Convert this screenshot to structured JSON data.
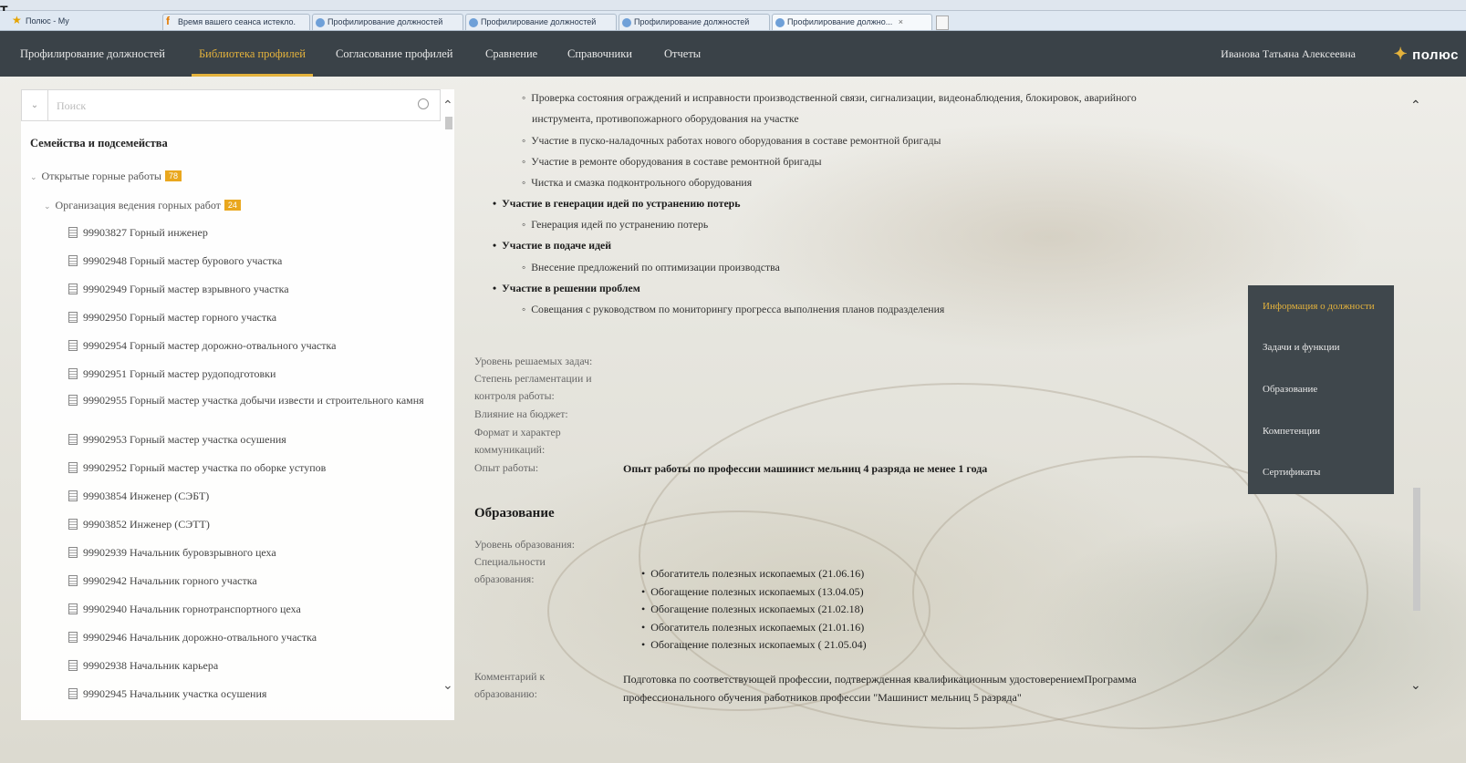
{
  "browser": {
    "corner_mark": "T",
    "tabs": [
      {
        "label": "Полюс - My"
      },
      {
        "label": "Время вашего сеанса истекло."
      },
      {
        "label": "Профилирование должностей"
      },
      {
        "label": "Профилирование должностей"
      },
      {
        "label": "Профилирование должностей"
      },
      {
        "label": "Профилирование должно..."
      }
    ],
    "tab_close": "×"
  },
  "nav": {
    "items": [
      {
        "label": "Профилирование должностей"
      },
      {
        "label": "Библиотека профилей"
      },
      {
        "label": "Согласование профилей"
      },
      {
        "label": "Сравнение"
      },
      {
        "label": "Справочники"
      },
      {
        "label": "Отчеты"
      }
    ],
    "user": "Иванова Татьяна Алексеевна",
    "logo": "полюс",
    "accent_color": "#e4b23c"
  },
  "sidebar": {
    "search_placeholder": "Поиск",
    "families_title": "Семейства и подсемейства",
    "level1": {
      "label": "Открытые горные работы",
      "count": "78"
    },
    "level2": {
      "label": "Организация ведения горных работ",
      "count": "24"
    },
    "items": [
      {
        "label": "99903827 Горный инженер"
      },
      {
        "label": "99902948 Горный мастер бурового участка"
      },
      {
        "label": "99902949 Горный мастер взрывного участка"
      },
      {
        "label": "99902950 Горный мастер горного участка"
      },
      {
        "label": "99902954 Горный мастер дорожно-отвального участка"
      },
      {
        "label": "99902951 Горный мастер рудоподготовки"
      },
      {
        "label": "99902955 Горный мастер участка добычи извести и строительного камня"
      },
      {
        "label": "99902953 Горный мастер участка осушения"
      },
      {
        "label": "99902952 Горный мастер участка по оборке уступов"
      },
      {
        "label": "99903854 Инженер (СЭБТ)"
      },
      {
        "label": "99903852 Инженер (СЭТТ)"
      },
      {
        "label": "99902939 Начальник буровзрывного цеха"
      },
      {
        "label": "99902942 Начальник горного участка"
      },
      {
        "label": "99902940 Начальник горнотранспортного цеха"
      },
      {
        "label": "99902946 Начальник дорожно-отвального участка"
      },
      {
        "label": "99902938 Начальник карьера"
      },
      {
        "label": "99902945 Начальник участка осушения"
      }
    ]
  },
  "content": {
    "tasks": [
      {
        "text": "Проверка состояния ограждений и исправности производственной связи, сигнализации, видеонаблюдения, блокировок, аварийного",
        "level": "sub"
      },
      {
        "text": "инструмента, противопожарного оборудования на участке",
        "level": "cont"
      },
      {
        "text": "Участие в пуско-наладочных работах нового оборудования в составе ремонтной бригады",
        "level": "sub"
      },
      {
        "text": "Участие в ремонте оборудования в составе ремонтной бригады",
        "level": "sub"
      },
      {
        "text": "Чистка и смазка подконтрольного оборудования",
        "level": "sub"
      },
      {
        "text": "Участие в генерации идей по устранению потерь",
        "level": "bold"
      },
      {
        "text": "Генерация идей по устранению потерь",
        "level": "sub"
      },
      {
        "text": "Участие в подаче идей",
        "level": "bold"
      },
      {
        "text": "Внесение предложений по оптимизации производства",
        "level": "sub"
      },
      {
        "text": "Участие в решении проблем",
        "level": "bold"
      },
      {
        "text": "Совещания с руководством по мониторингу прогресса выполнения планов подразделения",
        "level": "sub"
      }
    ],
    "attributes": {
      "level_label": "Уровень решаемых задач:",
      "regulation_label_1": "Степень регламентации и",
      "regulation_label_2": "контроля работы:",
      "budget_label": "Влияние на бюджет:",
      "communication_label_1": "Формат и характер",
      "communication_label_2": "коммуникаций:",
      "experience_label": "Опыт работы:",
      "experience_value": "Опыт работы по профессии машинист мельниц 4 разряда не менее 1 года"
    },
    "education": {
      "title": "Образование",
      "level_label": "Уровень образования:",
      "spec_label_1": "Специальности",
      "spec_label_2": "образования:",
      "specialties": [
        "Обогатитель полезных ископаемых (21.06.16)",
        "Обогащение полезных ископаемых (13.04.05)",
        "Обогащение полезных ископаемых (21.02.18)",
        "Обогатитель полезных ископаемых (21.01.16)",
        "Обогащение полезных ископаемых ( 21.05.04)"
      ],
      "comment_label_1": "Комментарий к",
      "comment_label_2": "образованию:",
      "comment_value_1": "Подготовка по соответствующей профессии, подтвержденная квалификационным удостоверениемПрограмма",
      "comment_value_2": "профессионального обучения работников профессии \"Машинист мельниц 5 разряда\""
    }
  },
  "right_nav": {
    "items": [
      {
        "label": "Информация о должности"
      },
      {
        "label": "Задачи и функции"
      },
      {
        "label": "Образование"
      },
      {
        "label": "Компетенции"
      },
      {
        "label": "Сертификаты"
      }
    ]
  },
  "icons": {
    "bullet": "•",
    "sub_bullet": "◦",
    "arrow_up": "⌃",
    "arrow_down": "⌄",
    "tree_arrow": "⌄",
    "logo_star": "✦"
  }
}
